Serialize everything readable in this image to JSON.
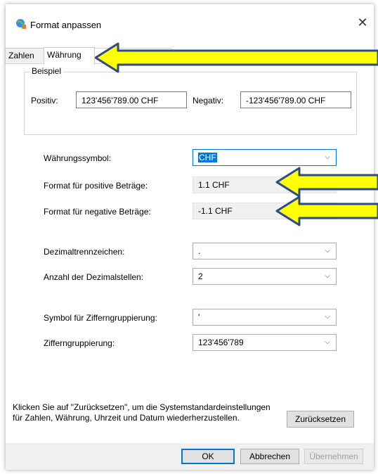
{
  "window": {
    "title": "Format anpassen",
    "close_glyph": "✕"
  },
  "tabs": [
    {
      "label": "Zahlen"
    },
    {
      "label": "Währung"
    },
    {
      "label": ""
    }
  ],
  "example": {
    "group_title": "Beispiel",
    "positive_label": "Positiv:",
    "positive_value": "123'456'789.00 CHF",
    "negative_label": "Negativ:",
    "negative_value": "-123'456'789.00 CHF"
  },
  "fields": {
    "currency_symbol": {
      "label": "Währungssymbol:",
      "value": "CHF"
    },
    "positive_format": {
      "label": "Format für positive Beträge:",
      "value": "1.1 CHF"
    },
    "negative_format": {
      "label": "Format für negative Beträge:",
      "value": "-1.1 CHF"
    },
    "decimal_separator": {
      "label": "Dezimaltrennzeichen:",
      "value": "."
    },
    "decimal_places": {
      "label": "Anzahl der Dezimalstellen:",
      "value": "2"
    },
    "grouping_symbol": {
      "label": "Symbol für Zifferngruppierung:",
      "value": "'"
    },
    "digit_grouping": {
      "label": "Zifferngruppierung:",
      "value": "123'456'789"
    }
  },
  "reset_info": "Klicken Sie auf \"Zurücksetzen\", um die Systemstandardeinstellungen für Zahlen, Währung, Uhrzeit und Datum wiederherzustellen.",
  "buttons": {
    "reset": "Zurücksetzen",
    "ok": "OK",
    "cancel": "Abbrechen",
    "apply": "Übernehmen"
  },
  "annotation": {
    "arrow_color": "#ffff00",
    "arrow_outline": "#2f4a8a"
  }
}
